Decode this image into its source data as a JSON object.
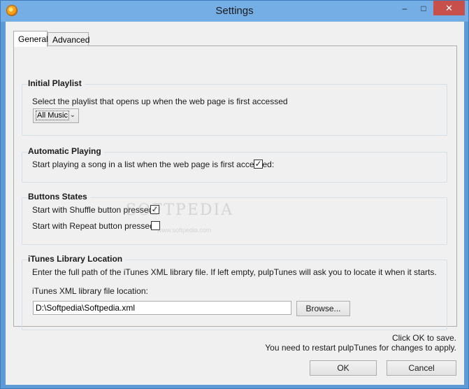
{
  "window": {
    "title": "Settings",
    "icon": "pulptunes-app-icon",
    "controls": {
      "minimize": "–",
      "maximize": "□",
      "close": "✕"
    }
  },
  "tabs": [
    {
      "label": "General",
      "active": true
    },
    {
      "label": "Advanced",
      "active": false
    }
  ],
  "initial_playlist": {
    "legend": "Initial Playlist",
    "description": "Select the playlist that opens up when the web page is first accessed",
    "selected": "All Music"
  },
  "automatic_playing": {
    "legend": "Automatic Playing",
    "label": "Start playing a song in a list when the web page is first accessed:",
    "checked": true
  },
  "buttons_states": {
    "legend": "Buttons States",
    "shuffle_label": "Start with Shuffle button pressed:",
    "shuffle_checked": true,
    "repeat_label": "Start with Repeat button pressed:",
    "repeat_checked": false
  },
  "itunes_location": {
    "legend": "iTunes Library Location",
    "description": "Enter the full path of the iTunes XML library file. If left empty, pulpTunes will ask you to locate it when it starts.",
    "field_label": "iTunes XML library file location:",
    "path_value": "D:\\Softpedia\\Softpedia.xml",
    "browse_label": "Browse..."
  },
  "footer": {
    "note_save": "Click OK to save.",
    "note_restart": "You need to restart pulpTunes for changes to apply.",
    "ok_label": "OK",
    "cancel_label": "Cancel"
  },
  "watermark": {
    "text": "SOFTPEDIA",
    "subtext": "www.softpedia.com"
  },
  "colors": {
    "titlebar": "#74aee5",
    "close_button": "#c7504b",
    "panel": "#f0f0f0"
  }
}
